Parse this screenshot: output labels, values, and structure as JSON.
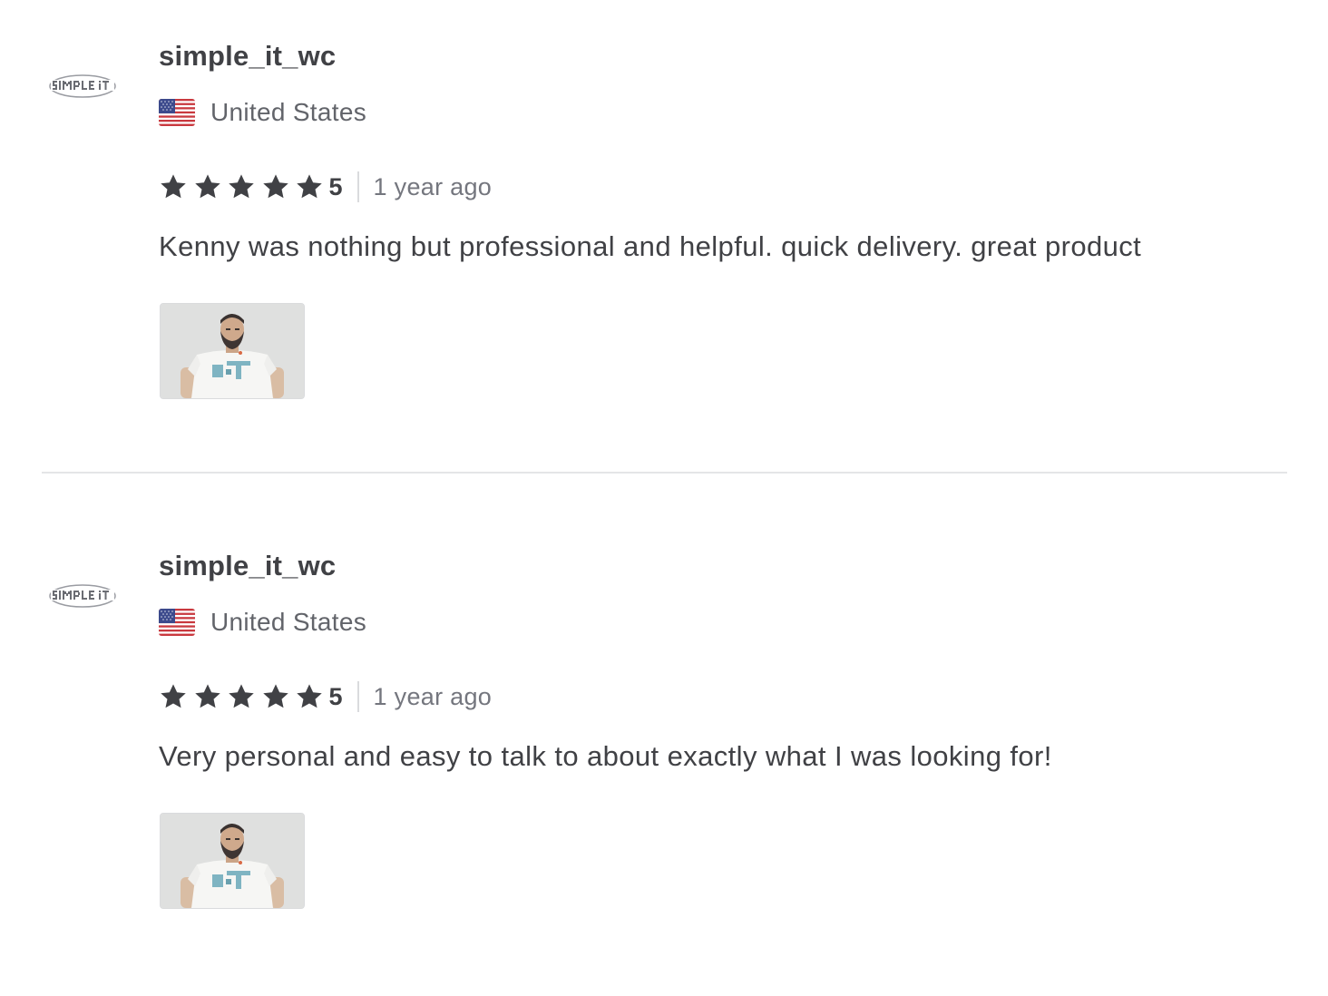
{
  "reviews": [
    {
      "username": "simple_it_wc",
      "avatar_text": "SIMPLE IT",
      "country": "United States",
      "flag_icon": "us-flag-icon",
      "rating": "5",
      "rating_out_of": 5,
      "time": "1 year ago",
      "text": "Kenny was nothing but professional and helpful. quick delivery. great product"
    },
    {
      "username": "simple_it_wc",
      "avatar_text": "SIMPLE IT",
      "country": "United States",
      "flag_icon": "us-flag-icon",
      "rating": "5",
      "rating_out_of": 5,
      "time": "1 year ago",
      "text": "Very personal and easy to talk to about exactly what I was looking for!"
    }
  ],
  "colors": {
    "text_primary": "#404145",
    "text_secondary": "#62646a",
    "text_muted": "#74767e",
    "star": "#404145",
    "divider": "#e4e5e7"
  }
}
